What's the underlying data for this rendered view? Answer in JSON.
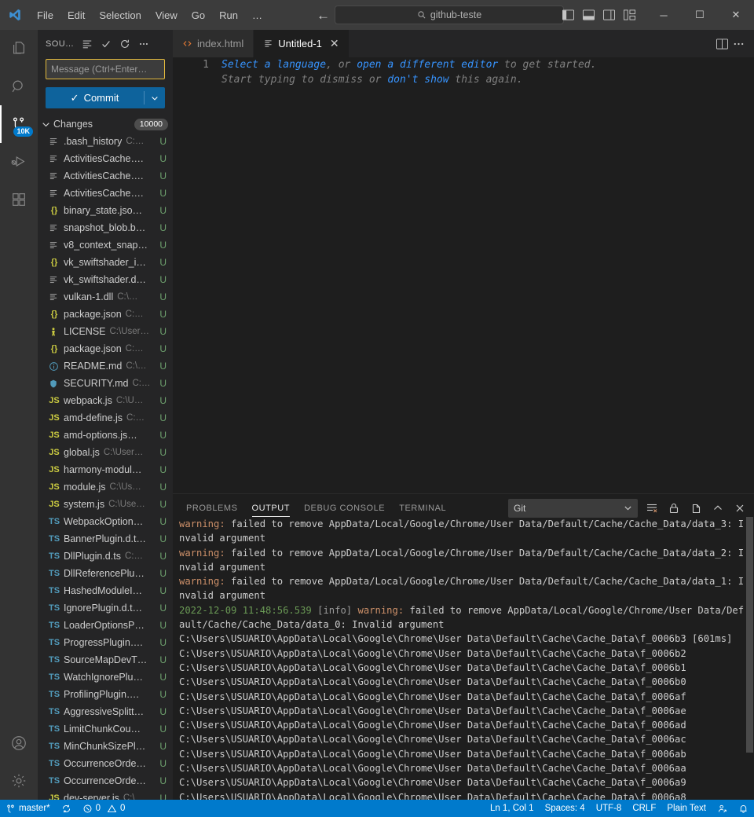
{
  "titlebar": {
    "menus": [
      "File",
      "Edit",
      "Selection",
      "View",
      "Go",
      "Run",
      "…"
    ],
    "search_value": "github-teste",
    "nav_back": "←",
    "nav_forward": "→",
    "minimize": "─",
    "maximize": "☐",
    "close": "✕"
  },
  "activitybar": {
    "items": [
      {
        "name": "explorer",
        "icon": "files-icon",
        "badge": ""
      },
      {
        "name": "search",
        "icon": "search-icon",
        "badge": ""
      },
      {
        "name": "source-control",
        "icon": "source-control-icon",
        "badge": "10K"
      },
      {
        "name": "run-debug",
        "icon": "run-debug-icon",
        "badge": ""
      },
      {
        "name": "extensions",
        "icon": "extensions-icon",
        "badge": ""
      }
    ],
    "bottom": [
      {
        "name": "accounts",
        "icon": "account-icon"
      },
      {
        "name": "settings",
        "icon": "gear-icon"
      }
    ]
  },
  "sidebar": {
    "title": "SOU…",
    "actions": [
      "view-as-tree-icon",
      "commit-check-icon",
      "refresh-icon",
      "more-actions-icon"
    ],
    "commit_message_placeholder": "Message (Ctrl+Enter…",
    "commit_button": "Commit",
    "commit_check": "✓",
    "commit_caret": "⌄",
    "changes_label": "Changes",
    "changes_count": "10000",
    "files": [
      {
        "icon": "txt",
        "name": ".bash_history",
        "path": "C:…",
        "status": "U"
      },
      {
        "icon": "txt",
        "name": "ActivitiesCache….",
        "path": "",
        "status": "U"
      },
      {
        "icon": "txt",
        "name": "ActivitiesCache….",
        "path": "",
        "status": "U"
      },
      {
        "icon": "txt",
        "name": "ActivitiesCache….",
        "path": "",
        "status": "U"
      },
      {
        "icon": "json",
        "name": "binary_state.jso…",
        "path": "",
        "status": "U"
      },
      {
        "icon": "txt",
        "name": "snapshot_blob.b…",
        "path": "",
        "status": "U"
      },
      {
        "icon": "txt",
        "name": "v8_context_snap…",
        "path": "",
        "status": "U"
      },
      {
        "icon": "json",
        "name": "vk_swiftshader_i…",
        "path": "",
        "status": "U"
      },
      {
        "icon": "txt",
        "name": "vk_swiftshader.d…",
        "path": "",
        "status": "U"
      },
      {
        "icon": "txt",
        "name": "vulkan-1.dll",
        "path": "C:\\…",
        "status": "U"
      },
      {
        "icon": "json",
        "name": "package.json",
        "path": "C:…",
        "status": "U"
      },
      {
        "icon": "license",
        "name": "LICENSE",
        "path": "C:\\User…",
        "status": "U"
      },
      {
        "icon": "json",
        "name": "package.json",
        "path": "C:…",
        "status": "U"
      },
      {
        "icon": "info",
        "name": "README.md",
        "path": "C:\\…",
        "status": "U"
      },
      {
        "icon": "shield",
        "name": "SECURITY.md",
        "path": "C:…",
        "status": "U"
      },
      {
        "icon": "js",
        "name": "webpack.js",
        "path": "C:\\U…",
        "status": "U"
      },
      {
        "icon": "js",
        "name": "amd-define.js",
        "path": "C:…",
        "status": "U"
      },
      {
        "icon": "js",
        "name": "amd-options.js…",
        "path": "",
        "status": "U"
      },
      {
        "icon": "js",
        "name": "global.js",
        "path": "C:\\User…",
        "status": "U"
      },
      {
        "icon": "js",
        "name": "harmony-modul…",
        "path": "",
        "status": "U"
      },
      {
        "icon": "js",
        "name": "module.js",
        "path": "C:\\Us…",
        "status": "U"
      },
      {
        "icon": "js",
        "name": "system.js",
        "path": "C:\\Use…",
        "status": "U"
      },
      {
        "icon": "ts",
        "name": "WebpackOption…",
        "path": "",
        "status": "U"
      },
      {
        "icon": "ts",
        "name": "BannerPlugin.d.t…",
        "path": "",
        "status": "U"
      },
      {
        "icon": "ts",
        "name": "DllPlugin.d.ts",
        "path": "C:…",
        "status": "U"
      },
      {
        "icon": "ts",
        "name": "DllReferencePlu…",
        "path": "",
        "status": "U"
      },
      {
        "icon": "ts",
        "name": "HashedModuleI…",
        "path": "",
        "status": "U"
      },
      {
        "icon": "ts",
        "name": "IgnorePlugin.d.t…",
        "path": "",
        "status": "U"
      },
      {
        "icon": "ts",
        "name": "LoaderOptionsP…",
        "path": "",
        "status": "U"
      },
      {
        "icon": "ts",
        "name": "ProgressPlugin….",
        "path": "",
        "status": "U"
      },
      {
        "icon": "ts",
        "name": "SourceMapDevT…",
        "path": "",
        "status": "U"
      },
      {
        "icon": "ts",
        "name": "WatchIgnorePlu…",
        "path": "",
        "status": "U"
      },
      {
        "icon": "ts",
        "name": "ProfilingPlugin….",
        "path": "",
        "status": "U"
      },
      {
        "icon": "ts",
        "name": "AggressiveSplitt…",
        "path": "",
        "status": "U"
      },
      {
        "icon": "ts",
        "name": "LimitChunkCou…",
        "path": "",
        "status": "U"
      },
      {
        "icon": "ts",
        "name": "MinChunkSizePl…",
        "path": "",
        "status": "U"
      },
      {
        "icon": "ts",
        "name": "OccurrenceOrde…",
        "path": "",
        "status": "U"
      },
      {
        "icon": "ts",
        "name": "OccurrenceOrde…",
        "path": "",
        "status": "U"
      },
      {
        "icon": "js",
        "name": "dev-server.js",
        "path": "C:\\",
        "status": "U"
      }
    ]
  },
  "editor": {
    "tabs": [
      {
        "label": "index.html",
        "icon": "html-icon",
        "active": false,
        "closable": false
      },
      {
        "label": "Untitled-1",
        "icon": "txt-icon",
        "active": true,
        "closable": true
      }
    ],
    "tab_actions": [
      "split-editor-icon",
      "more-actions-icon"
    ],
    "line_number": "1",
    "hint_line1_a": "Select a language",
    "hint_line1_b": ", or ",
    "hint_line1_c": "open a different editor",
    "hint_line1_d": " to get started.",
    "hint_line2_a": "Start typing to dismiss or ",
    "hint_line2_b": "don't show",
    "hint_line2_c": " this again."
  },
  "panel": {
    "tabs": [
      "PROBLEMS",
      "OUTPUT",
      "DEBUG CONSOLE",
      "TERMINAL"
    ],
    "active_tab": "OUTPUT",
    "channel": "Git",
    "actions": [
      "clear-output-icon",
      "lock-scroll-icon",
      "new-window-icon",
      "maximize-panel-icon",
      "close-panel-icon"
    ],
    "output_lines": [
      {
        "type": "path",
        "text": "C:\\Users\\USUARIO\\AppData\\Local\\Google\\Chrome\\User Data\\Default\\Cache\\Cache_Data\\f_0006a8"
      },
      {
        "type": "path",
        "text": "C:\\Users\\USUARIO\\AppData\\Local\\Google\\Chrome\\User Data\\Default\\Cache\\Cache_Data\\f_0006a9"
      },
      {
        "type": "path",
        "text": "C:\\Users\\USUARIO\\AppData\\Local\\Google\\Chrome\\User Data\\Default\\Cache\\Cache_Data\\f_0006aa"
      },
      {
        "type": "path",
        "text": "C:\\Users\\USUARIO\\AppData\\Local\\Google\\Chrome\\User Data\\Default\\Cache\\Cache_Data\\f_0006ab"
      },
      {
        "type": "path",
        "text": "C:\\Users\\USUARIO\\AppData\\Local\\Google\\Chrome\\User Data\\Default\\Cache\\Cache_Data\\f_0006ac"
      },
      {
        "type": "path",
        "text": "C:\\Users\\USUARIO\\AppData\\Local\\Google\\Chrome\\User Data\\Default\\Cache\\Cache_Data\\f_0006ad"
      },
      {
        "type": "path",
        "text": "C:\\Users\\USUARIO\\AppData\\Local\\Google\\Chrome\\User Data\\Default\\Cache\\Cache_Data\\f_0006ae"
      },
      {
        "type": "path",
        "text": "C:\\Users\\USUARIO\\AppData\\Local\\Google\\Chrome\\User Data\\Default\\Cache\\Cache_Data\\f_0006af"
      },
      {
        "type": "path",
        "text": "C:\\Users\\USUARIO\\AppData\\Local\\Google\\Chrome\\User Data\\Default\\Cache\\Cache_Data\\f_0006b0"
      },
      {
        "type": "path",
        "text": "C:\\Users\\USUARIO\\AppData\\Local\\Google\\Chrome\\User Data\\Default\\Cache\\Cache_Data\\f_0006b1"
      },
      {
        "type": "path",
        "text": "C:\\Users\\USUARIO\\AppData\\Local\\Google\\Chrome\\User Data\\Default\\Cache\\Cache_Data\\f_0006b2"
      },
      {
        "type": "path",
        "text": "C:\\Users\\USUARIO\\AppData\\Local\\Google\\Chrome\\User Data\\Default\\Cache\\Cache_Data\\f_0006b3 [601ms]"
      },
      {
        "type": "info_warn",
        "ts": "2022-12-09 11:48:56.539",
        "info": "[info]",
        "warn": "warning:",
        "rest": " failed to remove AppData/Local/Google/Chrome/User Data/Default/Cache/Cache_Data/data_0: Invalid argument"
      },
      {
        "type": "warn",
        "warn": "warning:",
        "rest": " failed to remove AppData/Local/Google/Chrome/User Data/Default/Cache/Cache_Data/data_1: Invalid argument"
      },
      {
        "type": "warn",
        "warn": "warning:",
        "rest": " failed to remove AppData/Local/Google/Chrome/User Data/Default/Cache/Cache_Data/data_2: Invalid argument"
      },
      {
        "type": "warn",
        "warn": "warning:",
        "rest": " failed to remove AppData/Local/Google/Chrome/User Data/Default/Cache/Cache_Data/data_3: Invalid argument"
      }
    ]
  },
  "statusbar": {
    "branch": "master*",
    "sync_icon": "sync-icon",
    "errors": "0",
    "warnings": "0",
    "cursor": "Ln 1, Col 1",
    "indent": "Spaces: 4",
    "encoding": "UTF-8",
    "eol": "CRLF",
    "language": "Plain Text",
    "feedback_icon": "feedback-icon",
    "bell_icon": "bell-icon"
  },
  "colors": {
    "accent": "#007acc",
    "panel_bg": "#1e1e1e",
    "sidebar_bg": "#252526",
    "activity_bg": "#333333",
    "titlebar_bg": "#3c3c3c",
    "warning": "#cd9069",
    "timestamp": "#6a9955",
    "status_u": "#6fa36f",
    "link": "#3794ff"
  }
}
